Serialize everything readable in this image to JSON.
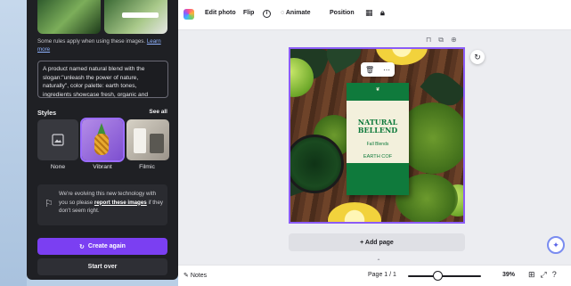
{
  "sidebar": {
    "rules_text": "Some rules apply when using these images.",
    "rules_link": "Learn more",
    "prompt_text": "A product named natural blend with the slogan:\"unleash the power of nature, naturally\", color palette: earth tones, ingredients showcase fresh, organic and",
    "styles_heading": "Styles",
    "see_all": "See all",
    "style_options": [
      {
        "label": "None"
      },
      {
        "label": "Vibrant"
      },
      {
        "label": "Filmic"
      }
    ],
    "notice_text": "We're evolving this new technology with you so please",
    "notice_link": "report these images",
    "notice_tail": "if they don't seem right.",
    "create_again": "Create again",
    "start_over": "Start over"
  },
  "toolbar": {
    "edit_photo": "Edit photo",
    "flip": "Flip",
    "info": "i",
    "animate": "Animate",
    "position": "Position"
  },
  "canvas": {
    "package_title_line1": "NATURAL",
    "package_title_line2": "BELLEND",
    "package_small": "Fall Blends",
    "package_earth": "EARTH COF",
    "add_page": "+ Add page"
  },
  "bottom_bar": {
    "notes": "Notes",
    "page": "Page 1 / 1",
    "zoom": "39%",
    "zoom_level": 0.39
  },
  "colors": {
    "accent": "#7b3ff2",
    "panel_bg": "#1f2024",
    "selection": "#8b5cf6",
    "package_green": "#0f7a3c"
  }
}
